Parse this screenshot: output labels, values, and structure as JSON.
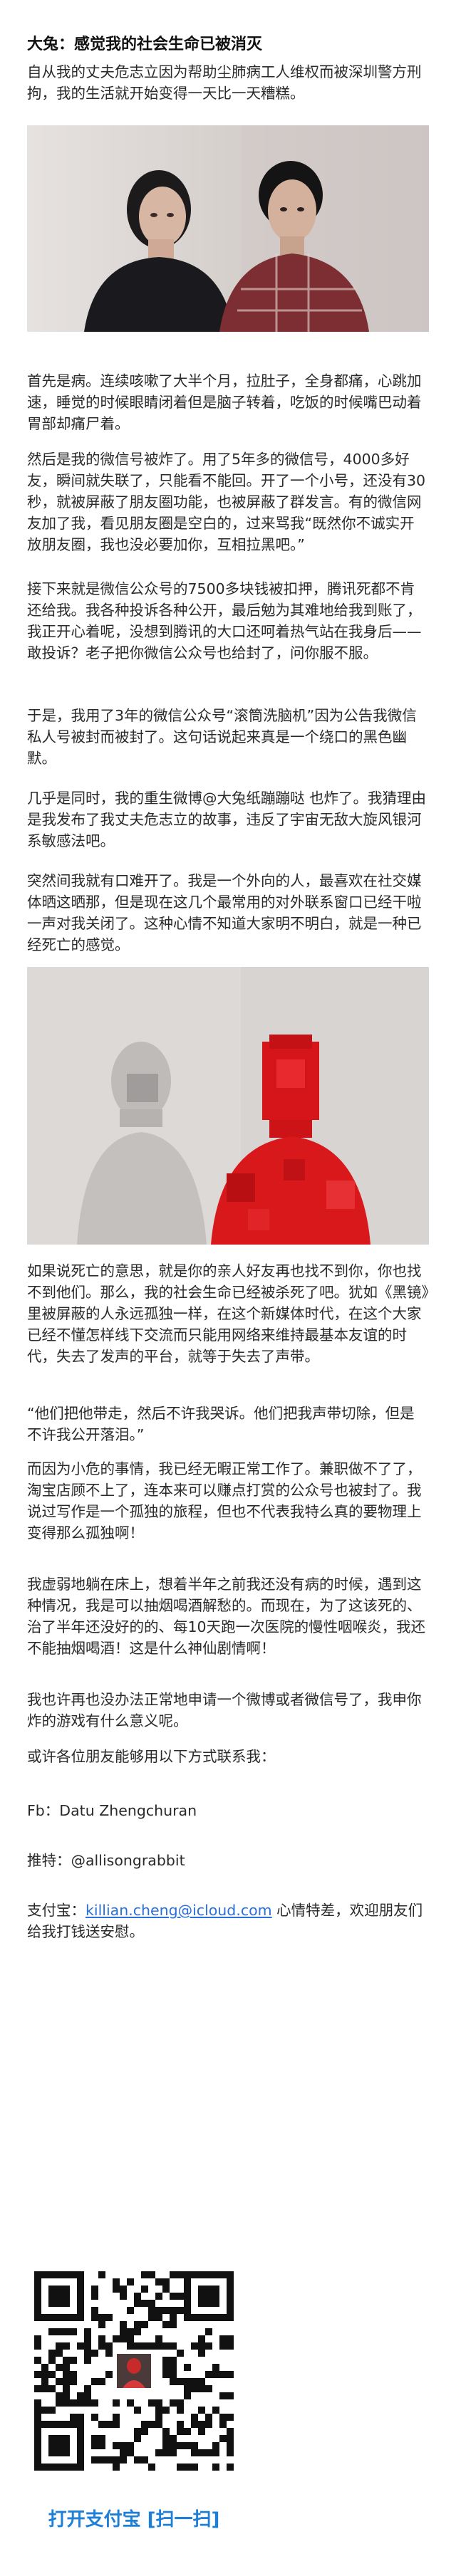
{
  "article": {
    "title": "大兔：感觉我的社会生命已被消灭",
    "intro": "自从我的丈夫危志立因为帮助尘肺病工人维权而被深圳警方刑拘，我的生活就开始变得一天比一天糟糕。",
    "p_illness": "首先是病。连续咳嗽了大半个月，拉肚子，全身都痛，心跳加速，睡觉的时候眼睛闭着但是脑子转着，吃饭的时候嘴巴动着胃部却痛尸着。",
    "p_wechat": "然后是我的微信号被炸了。用了5年多的微信号，4000多好友，瞬间就失联了，只能看不能回。开了一个小号，还没有30秒，就被屏蔽了朋友圈功能，也被屏蔽了群发言。有的微信网友加了我，看见朋友圈是空白的，过来骂我“既然你不诚实开放朋友圈，我也没必要加你，互相拉黑吧。”",
    "p_money": "接下来就是微信公众号的7500多块钱被扣押，腾讯死都不肯还给我。我各种投诉各种公开，最后勉为其难地给我到账了，我正开心着呢，没想到腾讯的大口还呵着热气站在我身后——敢投诉？老子把你微信公众号也给封了，问你服不服。",
    "p_account": "于是，我用了3年的微信公众号“滚筒洗脑机”因为公告我微信私人号被封而被封了。这句话说起来真是一个绕口的黑色幽默。",
    "p_weibo": "几乎是同时，我的重生微博@大兔纸蹦蹦哒 也炸了。我猜理由是我发布了我丈夫危志立的故事，违反了宇宙无敌大旋风银河系敏感法吧。",
    "p_lonely": "突然间我就有口难开了。我是一个外向的人，最喜欢在社交媒体晒这晒那，但是现在这几个最常用的对外联系窗口已经干啦一声对我关闭了。这种心情不知道大家明不明白，就是一种已经死亡的感觉。",
    "p_death": "如果说死亡的意思，就是你的亲人好友再也找不到你，你也找不到他们。那么，我的社会生命已经被杀死了吧。犹如《黑镜》里被屏蔽的人永远孤独一样，在这个新媒体时代，在这个大家已经不懂怎样线下交流而只能用网络来维持最基本友谊的时代，失去了发声的平台，就等于失去了声带。",
    "p_quote": "“他们把他带走，然后不许我哭诉。他们把我声带切除，但是不许我公开落泪。”",
    "p_work": "而因为小危的事情，我已经无暇正常工作了。兼职做不了了，淘宝店顾不上了，连本来可以赚点打赏的公众号也被封了。我说过写作是一个孤独的旅程，但也不代表我特么真的要物理上变得那么孤独啊！",
    "p_sick": "我虚弱地躺在床上，想着半年之前我还没有病的时候，遇到这种情况，我是可以抽烟喝酒解愁的。而现在，为了这该死的、治了半年还没好的的、每10天跑一次医院的慢性咽喉炎，我还不能抽烟喝酒！这是什么神仙剧情啊！",
    "p_ask": "我也许再也没办法正常地申请一个微博或者微信号了，我申你炸的游戏有什么意义呢。",
    "p_contact_intro": "或许各位朋友能够用以下方式联系我：",
    "fb_line": "Fb：Datu Zhengchuran",
    "twitter_label": "推特：",
    "twitter_handle": "@allisongrabbit",
    "alipay_label": "支付宝：",
    "alipay_email": "killian.cheng@icloud.com",
    "alipay_suffix": " 心情特差，欢迎朋友们给我打钱送安慰。",
    "qr_caption": "打开支付宝 [扫一扫]"
  },
  "colors": {
    "link": "#2a6fdb",
    "qr_caption": "#1e7fd6",
    "photo_bg": "#d9d4d2",
    "shirt_red": "#d8181a"
  }
}
